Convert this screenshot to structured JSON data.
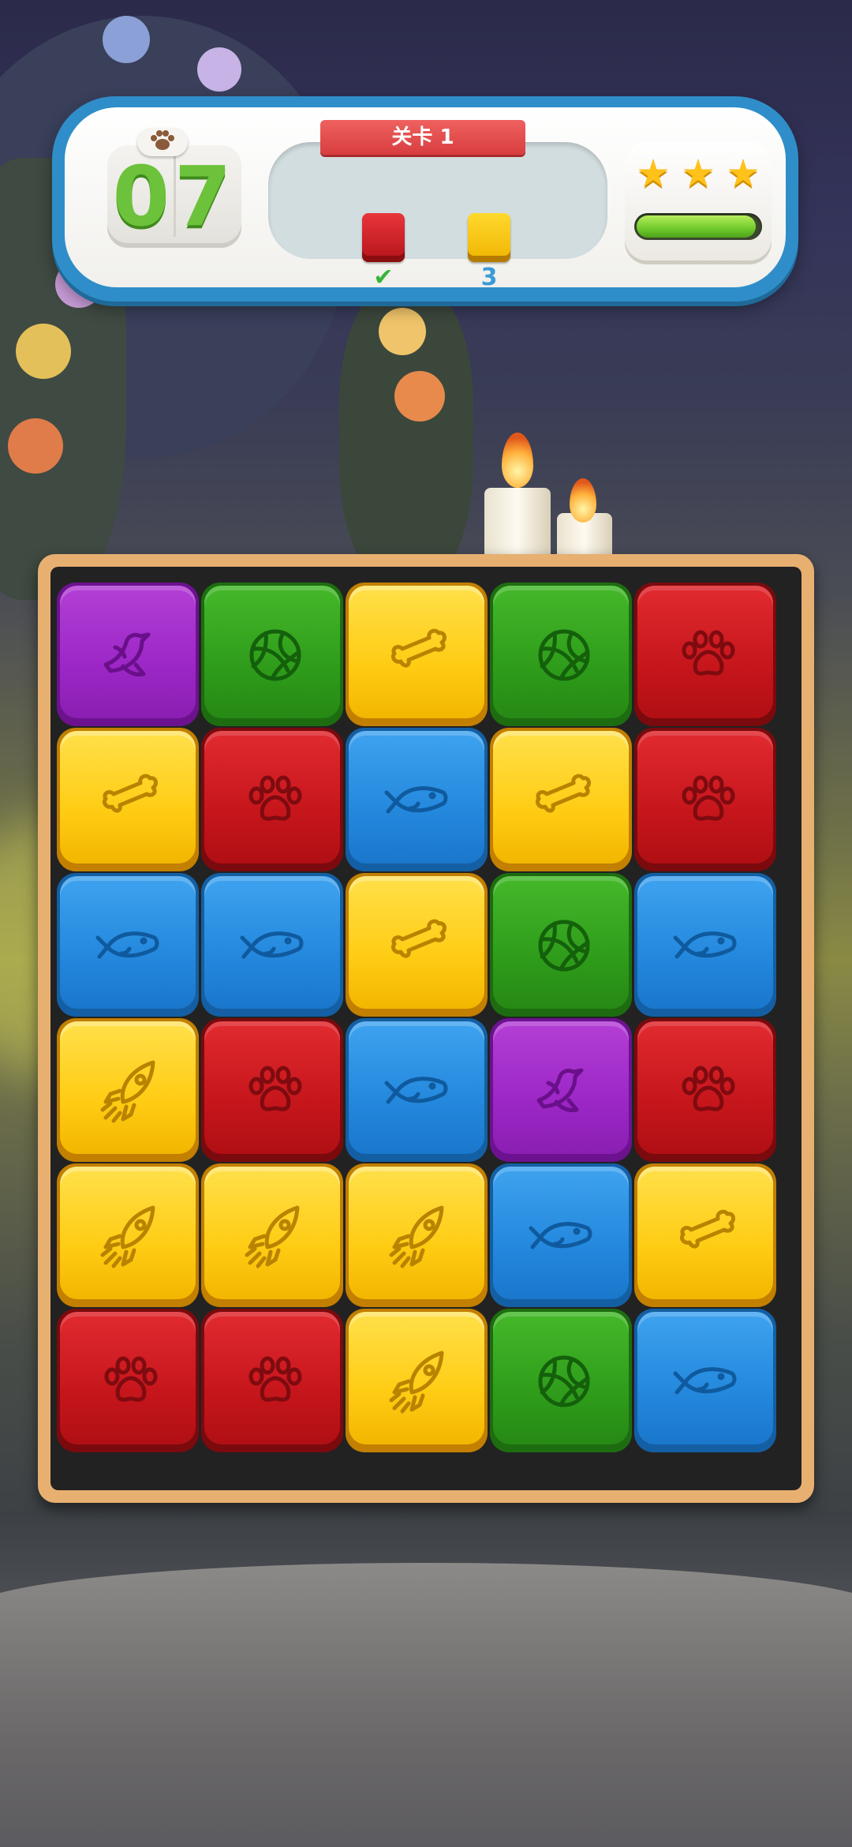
{
  "hud": {
    "moves_left": "07",
    "level_label": "关卡 1",
    "goals": [
      {
        "color": "red",
        "status": "✔"
      },
      {
        "color": "yellow",
        "status": "3"
      }
    ],
    "stars": 3,
    "score_progress": 0.97
  },
  "board": {
    "columns": 5,
    "rows": 6,
    "tiles": [
      [
        {
          "color": "purple",
          "icon": "bird-icon"
        },
        {
          "color": "green",
          "icon": "ball-icon"
        },
        {
          "color": "yellow",
          "icon": "bone-icon"
        },
        {
          "color": "green",
          "icon": "ball-icon"
        },
        {
          "color": "red",
          "icon": "paw-icon"
        }
      ],
      [
        {
          "color": "yellow",
          "icon": "bone-icon"
        },
        {
          "color": "red",
          "icon": "paw-icon"
        },
        {
          "color": "blue",
          "icon": "fish-icon"
        },
        {
          "color": "yellow",
          "icon": "bone-icon"
        },
        {
          "color": "red",
          "icon": "paw-icon"
        }
      ],
      [
        {
          "color": "blue",
          "icon": "fish-icon"
        },
        {
          "color": "blue",
          "icon": "fish-icon"
        },
        {
          "color": "yellow",
          "icon": "bone-icon"
        },
        {
          "color": "green",
          "icon": "ball-icon"
        },
        {
          "color": "blue",
          "icon": "fish-icon"
        }
      ],
      [
        {
          "color": "yellow",
          "icon": "rocket-icon"
        },
        {
          "color": "red",
          "icon": "paw-icon"
        },
        {
          "color": "blue",
          "icon": "fish-icon"
        },
        {
          "color": "purple",
          "icon": "bird-icon"
        },
        {
          "color": "red",
          "icon": "paw-icon"
        }
      ],
      [
        {
          "color": "yellow",
          "icon": "rocket-icon"
        },
        {
          "color": "yellow",
          "icon": "rocket-icon"
        },
        {
          "color": "yellow",
          "icon": "rocket-icon"
        },
        {
          "color": "blue",
          "icon": "fish-icon"
        },
        {
          "color": "yellow",
          "icon": "bone-icon"
        }
      ],
      [
        {
          "color": "red",
          "icon": "paw-icon"
        },
        {
          "color": "red",
          "icon": "paw-icon"
        },
        {
          "color": "yellow",
          "icon": "rocket-icon"
        },
        {
          "color": "green",
          "icon": "ball-icon"
        },
        {
          "color": "blue",
          "icon": "fish-icon"
        }
      ]
    ]
  }
}
